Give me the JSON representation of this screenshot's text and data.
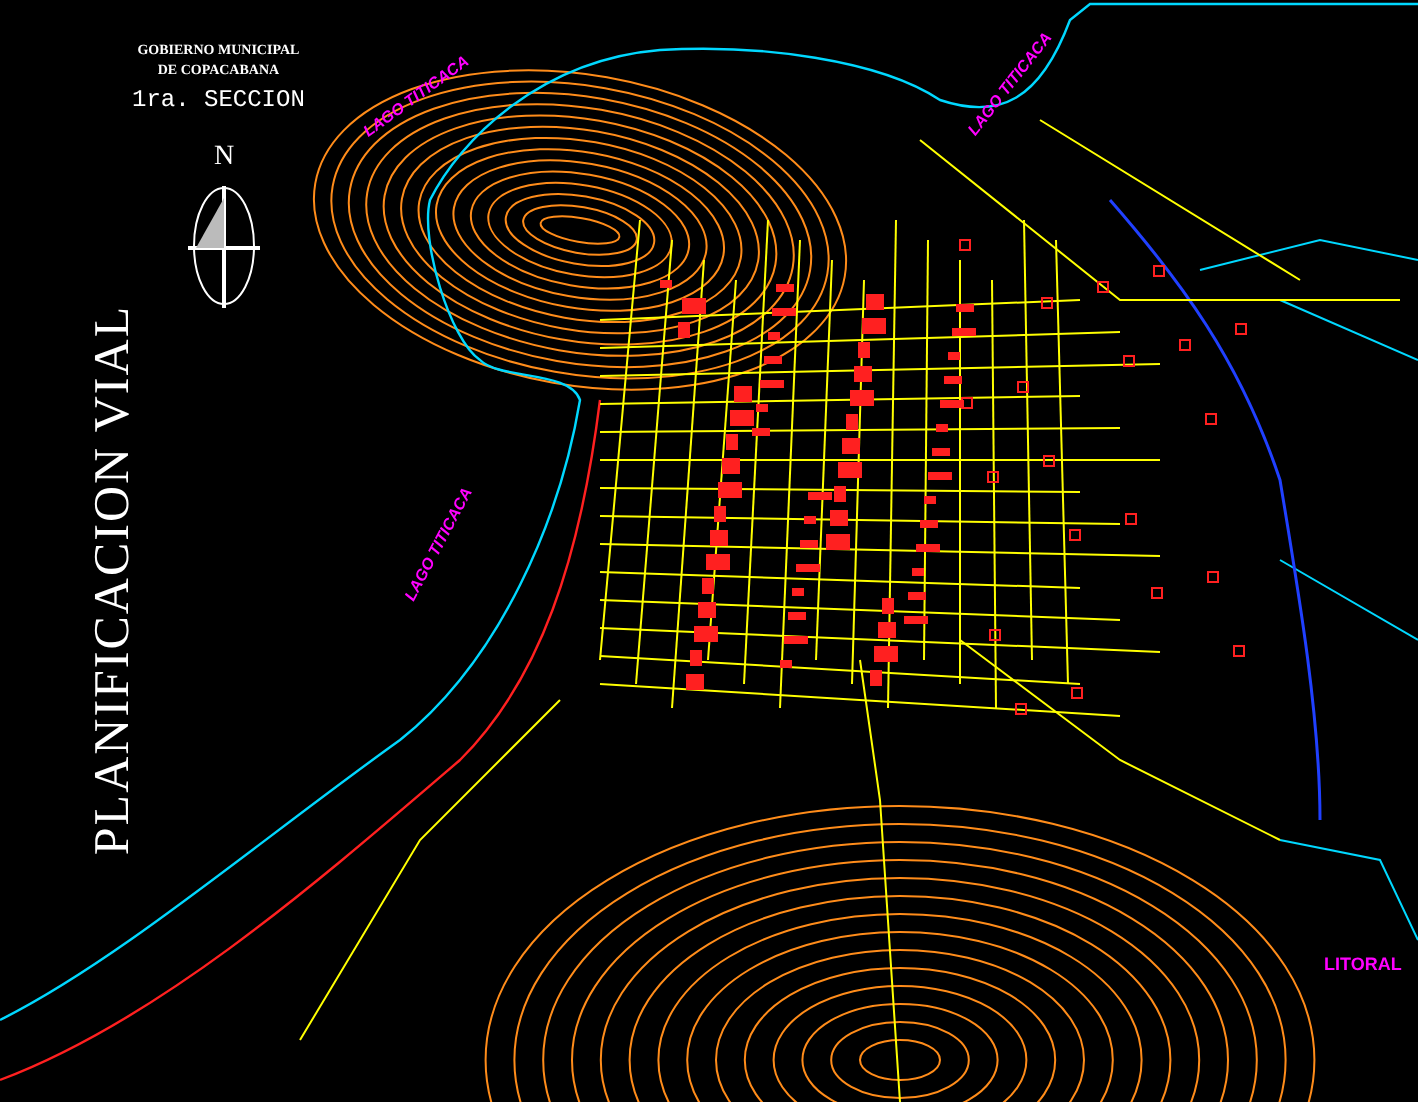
{
  "header": {
    "lines": [
      "GOBIERNO MUNICIPAL",
      "DE COPACABANA"
    ],
    "section": "1ra. SECCION"
  },
  "north": {
    "label": "N"
  },
  "title": "PLANIFICACION VIAL",
  "labels": [
    {
      "kind": "lake",
      "text": "LAGO TITICACA"
    },
    {
      "kind": "lake",
      "text": "LAGO TITICACA"
    },
    {
      "kind": "lake",
      "text": "LAGO TITICACA"
    },
    {
      "kind": "zone",
      "text": "LITORAL"
    }
  ]
}
